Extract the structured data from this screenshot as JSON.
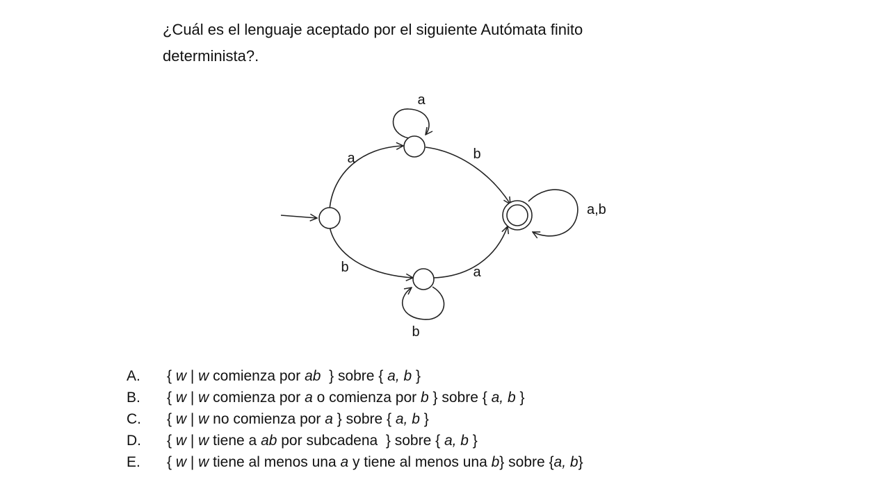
{
  "question": {
    "line1": "¿Cuál es el lenguaje  aceptado por el siguiente Autómata finito",
    "line2": "determinista?."
  },
  "diagram": {
    "labels": {
      "loop_top": "a",
      "start_to_top": "a",
      "top_to_final": "b",
      "loop_final": "a,b",
      "start_to_bottom": "b",
      "bottom_to_final": "a",
      "loop_bottom": "b"
    }
  },
  "options": [
    {
      "letter": "A.",
      "parts": [
        {
          "t": "{ ",
          "i": false
        },
        {
          "t": "w",
          "i": true
        },
        {
          "t": " | ",
          "i": false
        },
        {
          "t": "w",
          "i": true
        },
        {
          "t": " comienza por ",
          "i": false
        },
        {
          "t": "ab",
          "i": true
        },
        {
          "t": "  } sobre { ",
          "i": false
        },
        {
          "t": "a, b",
          "i": true
        },
        {
          "t": " }",
          "i": false
        }
      ]
    },
    {
      "letter": "B.",
      "parts": [
        {
          "t": "{ ",
          "i": false
        },
        {
          "t": "w",
          "i": true
        },
        {
          "t": " | ",
          "i": false
        },
        {
          "t": "w",
          "i": true
        },
        {
          "t": " comienza por ",
          "i": false
        },
        {
          "t": "a",
          "i": true
        },
        {
          "t": " o comienza por ",
          "i": false
        },
        {
          "t": "b",
          "i": true
        },
        {
          "t": " } sobre { ",
          "i": false
        },
        {
          "t": "a, b",
          "i": true
        },
        {
          "t": " }",
          "i": false
        }
      ]
    },
    {
      "letter": "C.",
      "parts": [
        {
          "t": "{ ",
          "i": false
        },
        {
          "t": "w",
          "i": true
        },
        {
          "t": " | ",
          "i": false
        },
        {
          "t": "w",
          "i": true
        },
        {
          "t": " no comienza por ",
          "i": false
        },
        {
          "t": "a",
          "i": true
        },
        {
          "t": " } sobre { ",
          "i": false
        },
        {
          "t": "a, b",
          "i": true
        },
        {
          "t": " }",
          "i": false
        }
      ]
    },
    {
      "letter": "D.",
      "parts": [
        {
          "t": "{ ",
          "i": false
        },
        {
          "t": "w",
          "i": true
        },
        {
          "t": " | ",
          "i": false
        },
        {
          "t": "w",
          "i": true
        },
        {
          "t": " tiene a ",
          "i": false
        },
        {
          "t": "ab",
          "i": true
        },
        {
          "t": " por subcadena  } sobre { ",
          "i": false
        },
        {
          "t": "a, b",
          "i": true
        },
        {
          "t": " }",
          "i": false
        }
      ]
    },
    {
      "letter": "E.",
      "parts": [
        {
          "t": "{ ",
          "i": false
        },
        {
          "t": "w",
          "i": true
        },
        {
          "t": " | ",
          "i": false
        },
        {
          "t": "w",
          "i": true
        },
        {
          "t": " tiene al menos una ",
          "i": false
        },
        {
          "t": "a",
          "i": true
        },
        {
          "t": " y tiene al menos una ",
          "i": false
        },
        {
          "t": "b",
          "i": true
        },
        {
          "t": "} sobre {",
          "i": false
        },
        {
          "t": "a, b",
          "i": true
        },
        {
          "t": "}",
          "i": false
        }
      ]
    }
  ]
}
